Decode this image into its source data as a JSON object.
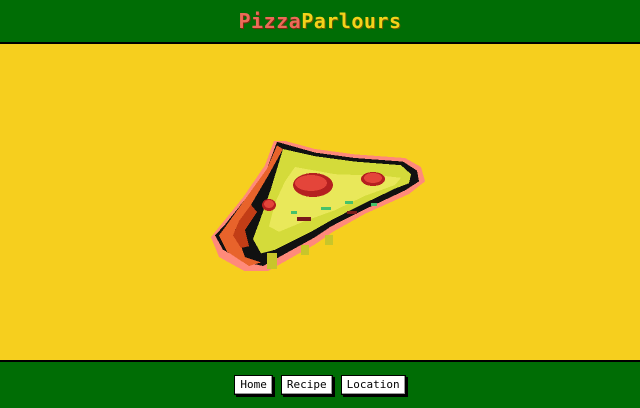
{
  "header": {
    "title_part1": "Pizza",
    "title_part2": "Parlours"
  },
  "main": {
    "image_icon": "pizza-slice-icon"
  },
  "nav": {
    "home": "Home",
    "recipe": "Recipe",
    "location": "Location"
  },
  "colors": {
    "background": "#f6cf1e",
    "bar": "#006d05",
    "title_red": "#ec6a58",
    "title_yellow": "#f3d21a"
  }
}
